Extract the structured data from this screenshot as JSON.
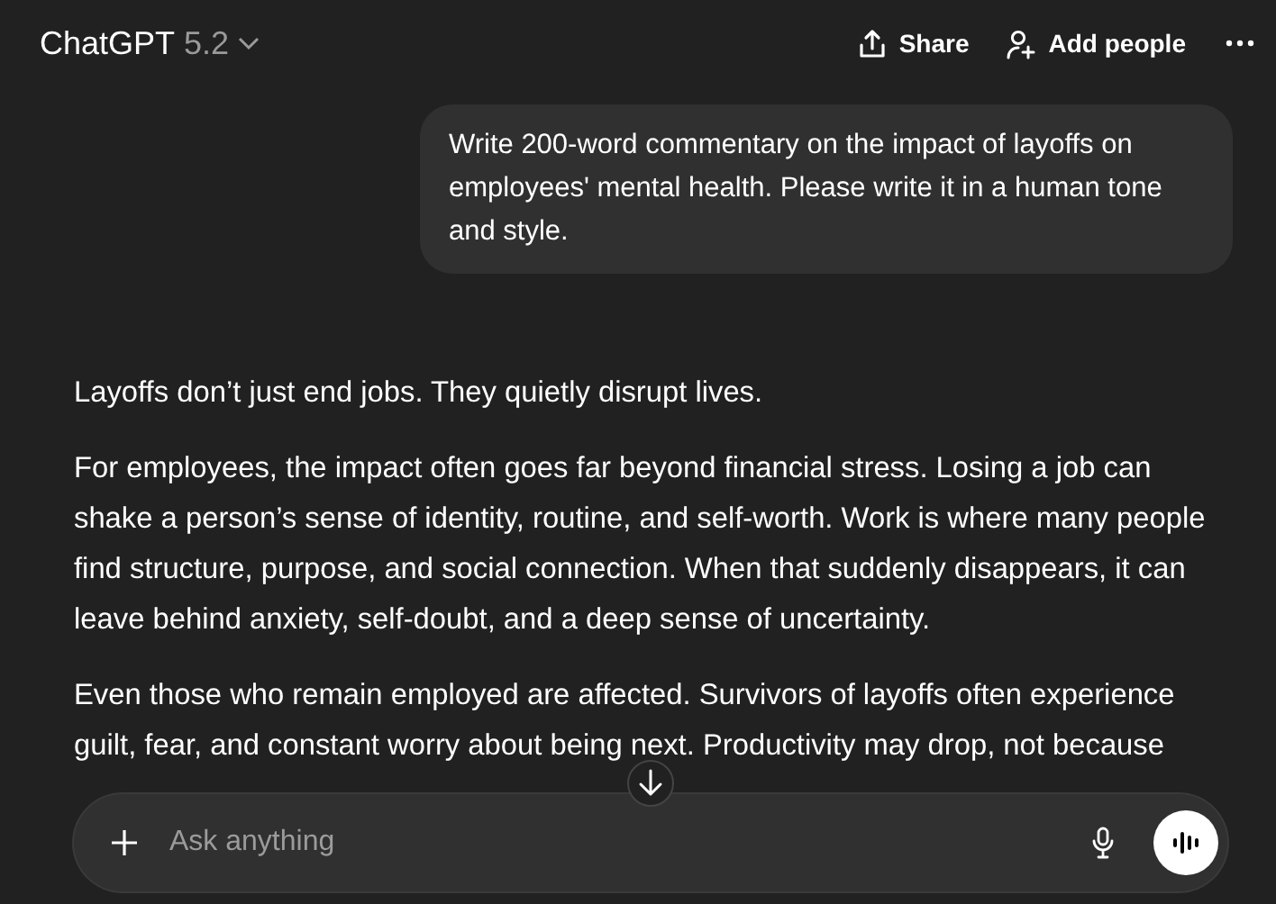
{
  "header": {
    "model_name": "ChatGPT",
    "model_version": "5.2",
    "actions": [
      {
        "kind": "share",
        "label": "Share"
      },
      {
        "kind": "add-people",
        "label": "Add people"
      },
      {
        "kind": "more"
      }
    ]
  },
  "messages": [
    {
      "kind": "user",
      "paragraphs": [
        "Write 200-word commentary on the impact of layoffs on employees' mental health. Please write it in a human tone and style."
      ]
    },
    {
      "kind": "assistant",
      "paragraphs": [
        "Layoffs don’t just end jobs. They quietly disrupt lives.",
        "For employees, the impact often goes far beyond financial stress. Losing a job can shake a person’s sense of identity, routine, and self-worth. Work is where many people find structure, purpose, and social connection. When that suddenly disappears, it can leave behind anxiety, self-doubt, and a deep sense of uncertainty.",
        "Even those who remain employed are affected. Survivors of layoffs often experience guilt, fear, and constant worry about being next. Productivity may drop, not because"
      ]
    }
  ],
  "composer": {
    "placeholder": "Ask anything"
  }
}
